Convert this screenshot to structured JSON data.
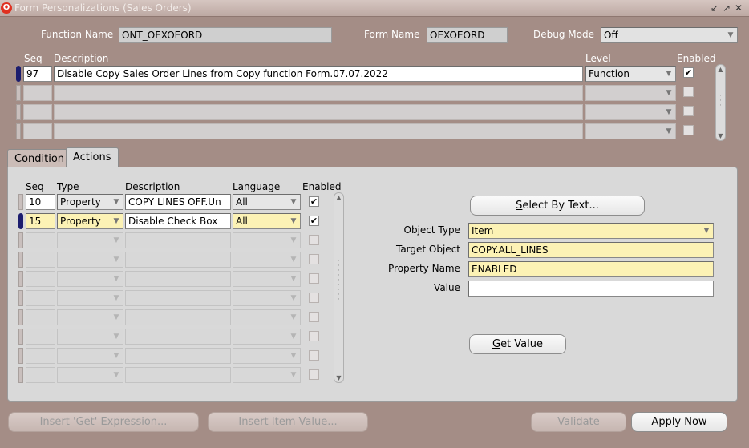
{
  "window": {
    "title": "Form Personalizations (Sales Orders)"
  },
  "header": {
    "function_name_label": "Function Name",
    "function_name_value": "ONT_OEXOEORD",
    "form_name_label": "Form Name",
    "form_name_value": "OEXOEORD",
    "debug_mode_label": "Debug Mode",
    "debug_mode_value": "Off"
  },
  "rules": {
    "col_seq": "Seq",
    "col_description": "Description",
    "col_level": "Level",
    "col_enabled": "Enabled",
    "rows": [
      {
        "seq": "97",
        "description": "Disable Copy Sales Order Lines from Copy function Form.07.07.2022",
        "level": "Function",
        "enabled": "✔"
      },
      {
        "seq": "",
        "description": "",
        "level": "",
        "enabled": ""
      },
      {
        "seq": "",
        "description": "",
        "level": "",
        "enabled": ""
      },
      {
        "seq": "",
        "description": "",
        "level": "",
        "enabled": ""
      }
    ]
  },
  "tabs": {
    "condition": "Condition",
    "actions": "Actions"
  },
  "actions": {
    "col_seq": "Seq",
    "col_type": "Type",
    "col_description": "Description",
    "col_language": "Language",
    "col_enabled": "Enabled",
    "rows": [
      {
        "seq": "10",
        "type": "Property",
        "description": "COPY LINES OFF.Un",
        "language": "All",
        "enabled": "✔"
      },
      {
        "seq": "15",
        "type": "Property",
        "description": "Disable Check Box",
        "language": "All",
        "enabled": "✔"
      }
    ]
  },
  "details": {
    "select_by_text_pre": "",
    "select_by_text_ul": "S",
    "select_by_text_post": "elect By Text...",
    "object_type_label": "Object Type",
    "object_type_value": "Item",
    "target_object_label": "Target Object",
    "target_object_value": "COPY.ALL_LINES",
    "property_name_label": "Property Name",
    "property_name_value": "ENABLED",
    "value_label": "Value",
    "value_value": "",
    "get_value_ul": "G",
    "get_value_post": "et Value"
  },
  "footer": {
    "insert_get_pre": "I",
    "insert_get_ul": "n",
    "insert_get_post": "sert 'Get' Expression...",
    "insert_item_pre": "Insert Item ",
    "insert_item_ul": "V",
    "insert_item_post": "alue...",
    "validate_pre": "Va",
    "validate_ul": "l",
    "validate_post": "idate",
    "apply_now": "Apply Now"
  },
  "colors": {
    "window_bg": "#a48d86",
    "required_field": "#fcf2b5",
    "panel": "#d9d9d9",
    "active_marker": "#1c1d6e"
  },
  "icons": [
    "oracle-logo-icon",
    "minimize-icon",
    "maximize-icon",
    "close-icon",
    "dropdown-arrow-icon",
    "scroll-up-icon",
    "scroll-down-icon"
  ]
}
